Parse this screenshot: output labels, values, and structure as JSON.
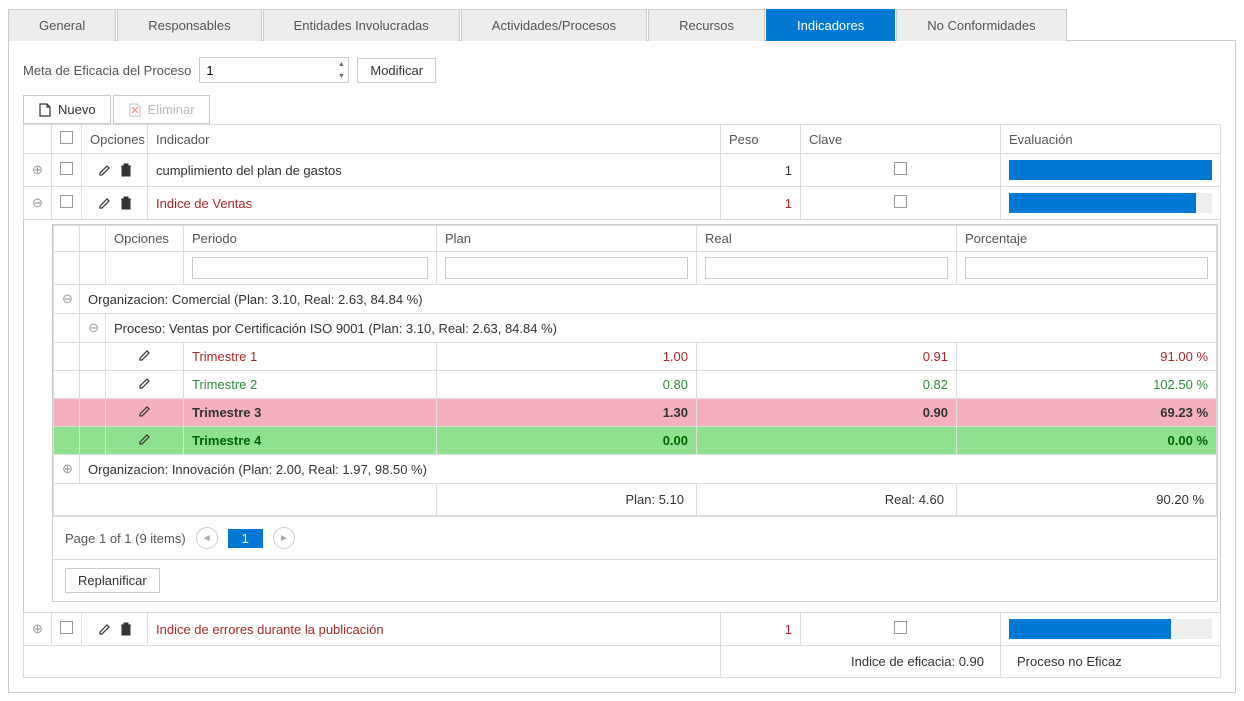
{
  "tabs": [
    "General",
    "Responsables",
    "Entidades Involucradas",
    "Actividades/Procesos",
    "Recursos",
    "Indicadores",
    "No Conformidades"
  ],
  "active_tab": "Indicadores",
  "meta": {
    "label": "Meta de Eficacia del Proceso",
    "value": "1",
    "modify": "Modificar"
  },
  "toolbar": {
    "nuevo": "Nuevo",
    "eliminar": "Eliminar"
  },
  "headers": {
    "opciones": "Opciones",
    "indicador": "Indicador",
    "peso": "Peso",
    "clave": "Clave",
    "evaluacion": "Evaluación"
  },
  "rows": [
    {
      "indicador": "cumplimiento del plan de gastos",
      "peso": "1",
      "eval_pct": 100,
      "bold": false
    },
    {
      "indicador": "Indice de Ventas",
      "peso": "1",
      "eval_pct": 92,
      "bold": true
    },
    {
      "indicador": "Indice de errores durante la publicación",
      "peso": "1",
      "eval_pct": 80,
      "bold": true
    }
  ],
  "sub_headers": {
    "opciones": "Opciones",
    "periodo": "Periodo",
    "plan": "Plan",
    "real": "Real",
    "porcentaje": "Porcentaje"
  },
  "org1": {
    "label": "Organizacion: Comercial (Plan: 3.10, Real: 2.63, 84.84 %)",
    "proceso": "Proceso: Ventas por Certificación ISO 9001 (Plan: 3.10, Real: 2.63, 84.84 %)",
    "trims": [
      {
        "periodo": "Trimestre 1",
        "plan": "1.00",
        "real": "0.91",
        "pct": "91.00 %",
        "cls": "trim-red"
      },
      {
        "periodo": "Trimestre 2",
        "plan": "0.80",
        "real": "0.82",
        "pct": "102.50 %",
        "cls": "trim-green"
      },
      {
        "periodo": "Trimestre 3",
        "plan": "1.30",
        "real": "0.90",
        "pct": "69.23 %",
        "cls": "trim-pink"
      },
      {
        "periodo": "Trimestre 4",
        "plan": "0.00",
        "real": "",
        "pct": "0.00 %",
        "cls": "trim-greenbg"
      }
    ]
  },
  "org2": {
    "label": "Organizacion: Innovación (Plan: 2.00, Real: 1.97, 98.50 %)"
  },
  "totals": {
    "plan": "Plan: 5.10",
    "real": "Real: 4.60",
    "pct": "90.20 %"
  },
  "pager": {
    "text": "Page 1 of 1 (9 items)",
    "page": "1"
  },
  "replan": "Replanificar",
  "summary": {
    "indice": "Indice de eficacia: 0.90",
    "estado": "Proceso no Eficaz"
  }
}
